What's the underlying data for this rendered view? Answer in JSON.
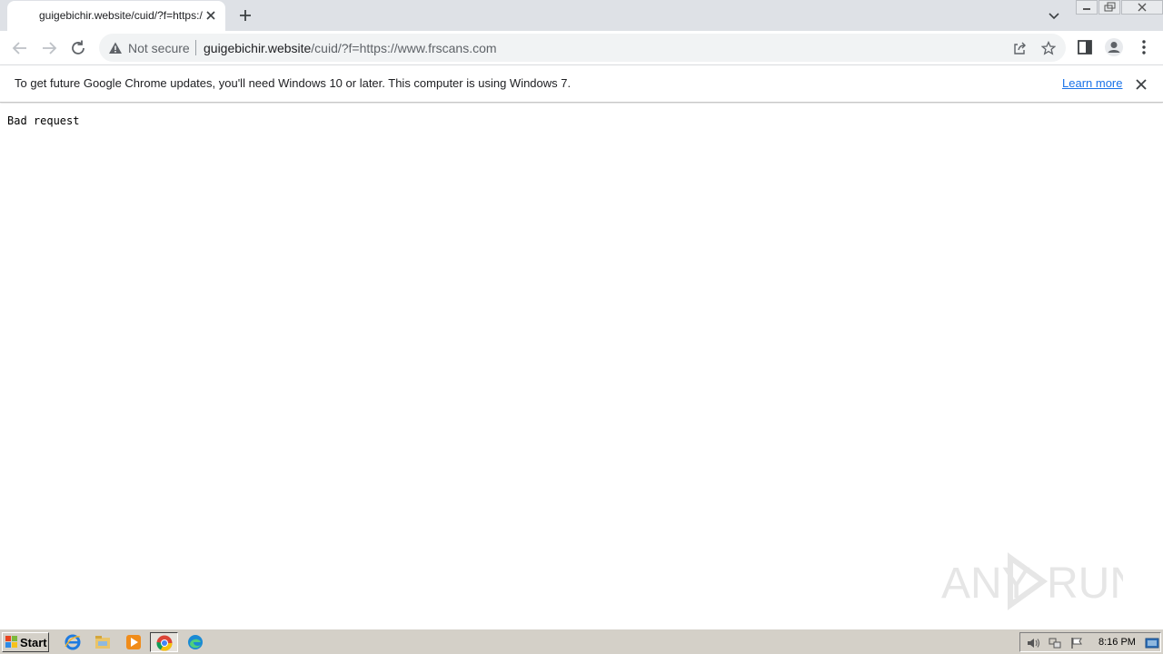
{
  "browser": {
    "tab": {
      "title": "guigebichir.website/cuid/?f=https://www.frscans.com"
    },
    "omnibox": {
      "security_label": "Not secure",
      "url_host": "guigebichir.website",
      "url_path": "/cuid/?f=https://www.frscans.com"
    },
    "infobar": {
      "message": "To get future Google Chrome updates, you'll need Windows 10 or later. This computer is using Windows 7.",
      "link": "Learn more"
    }
  },
  "page": {
    "body_text": "Bad request"
  },
  "watermark": {
    "text": "ANY RUN"
  },
  "taskbar": {
    "start_label": "Start",
    "clock": "8:16 PM"
  }
}
